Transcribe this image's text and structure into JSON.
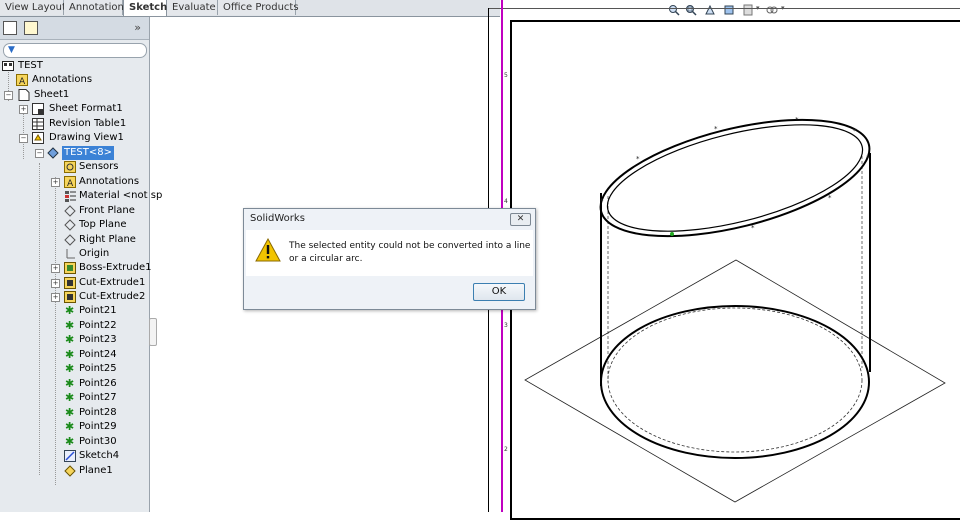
{
  "tabs": [
    {
      "label": "View Layout",
      "active": false
    },
    {
      "label": "Annotation",
      "active": false
    },
    {
      "label": "Sketch",
      "active": true
    },
    {
      "label": "Evaluate",
      "active": false
    },
    {
      "label": "Office Products",
      "active": false
    }
  ],
  "view_tools": [
    "zoom-to-fit-icon",
    "zoom-area-icon",
    "pan-icon",
    "rotate-icon",
    "display-style-icon",
    "hide-show-icon"
  ],
  "tree": {
    "root": "TEST",
    "annotations_top": "Annotations",
    "sheet": "Sheet1",
    "sheet_format": "Sheet Format1",
    "revision_table": "Revision Table1",
    "drawing_view": "Drawing View1",
    "part": "TEST<8>",
    "sensors": "Sensors",
    "annotations": "Annotations",
    "material": "Material <not sp",
    "front_plane": "Front Plane",
    "top_plane": "Top Plane",
    "right_plane": "Right Plane",
    "origin": "Origin",
    "boss_extrude": "Boss-Extrude1",
    "cut_extrude1": "Cut-Extrude1",
    "cut_extrude2": "Cut-Extrude2",
    "points": [
      "Point21",
      "Point22",
      "Point23",
      "Point24",
      "Point25",
      "Point26",
      "Point27",
      "Point28",
      "Point29",
      "Point30"
    ],
    "sketch": "Sketch4",
    "plane": "Plane1"
  },
  "ruler_marks": [
    "5",
    "4",
    "3",
    "2"
  ],
  "dialog": {
    "title": "SolidWorks",
    "close": "✕",
    "message": "The selected entity could not be converted into a line or a circular arc.",
    "ok_label": "OK"
  },
  "colors": {
    "selection": "#3b82d6",
    "accent_line": "#c000c0",
    "warning": "#f2c400"
  }
}
